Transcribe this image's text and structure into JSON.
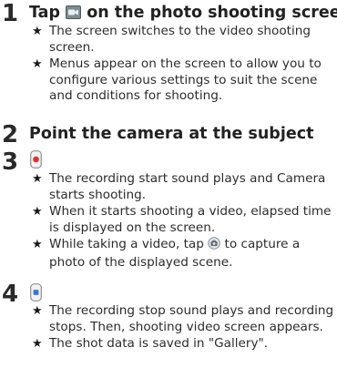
{
  "steps": [
    {
      "number": "1",
      "title_before": "Tap ",
      "title_icon": "video-mode-icon",
      "title_after": " on the photo shooting screen",
      "bullets": [
        "The screen switches to the video shooting screen.",
        "Menus appear on the screen to allow you to configure various settings to suit the scene and conditions for shooting."
      ]
    },
    {
      "number": "2",
      "title": "Point the camera at the subject"
    },
    {
      "number": "3",
      "button_icon": "record-start-icon",
      "bullets": [
        "The recording start sound plays and Camera starts shooting.",
        "When it starts shooting a video, elapsed time is displayed on the screen.",
        {
          "before": "While taking a video, tap ",
          "icon": "capture-photo-icon",
          "after": " to capture a photo of the displayed scene."
        }
      ]
    },
    {
      "number": "4",
      "button_icon": "record-stop-icon",
      "bullets": [
        "The recording stop sound plays and recording stops. Then, shooting video screen appears.",
        "The shot data is saved in \"Gallery\"."
      ]
    }
  ],
  "bullet_symbol": "★",
  "colors": {
    "text": "#2b2b2b",
    "record_red": "#e03030",
    "stop_blue": "#3a78d0"
  }
}
